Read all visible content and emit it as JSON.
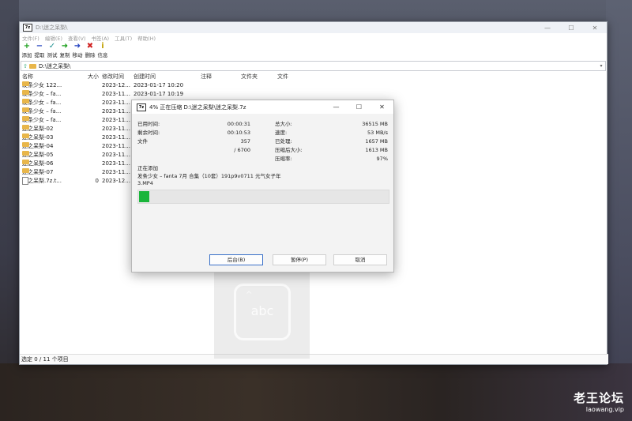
{
  "window": {
    "title": "D:\\迷之呆梨\\",
    "controls": [
      "—",
      "☐",
      "✕"
    ],
    "app_icon_label": "7z"
  },
  "menu": [
    "文件(F)",
    "编辑(E)",
    "查看(V)",
    "书签(A)",
    "工具(T)",
    "帮助(H)"
  ],
  "toolbar": [
    {
      "label": "添加",
      "icon": "add-icon",
      "glyph": "+",
      "color": "#1a9e1a"
    },
    {
      "label": "提取",
      "icon": "extract-icon",
      "glyph": "−",
      "color": "#2040c0"
    },
    {
      "label": "测试",
      "icon": "test-icon",
      "glyph": "✓",
      "color": "#209090"
    },
    {
      "label": "复制",
      "icon": "copy-icon",
      "glyph": "➜",
      "color": "#1a9e1a"
    },
    {
      "label": "移动",
      "icon": "move-icon",
      "glyph": "➜",
      "color": "#2040c0"
    },
    {
      "label": "删除",
      "icon": "delete-icon",
      "glyph": "✖",
      "color": "#d02020"
    },
    {
      "label": "信息",
      "icon": "info-icon",
      "glyph": "i",
      "color": "#c0a000"
    }
  ],
  "address": {
    "path": "D:\\迷之呆梨\\"
  },
  "columns": {
    "name": "名称",
    "size": "大小",
    "modified": "修改时间",
    "created": "创建时间",
    "comment": "注释",
    "folders": "文件夹",
    "files": "文件"
  },
  "rows": [
    {
      "name": "发条少女  122...",
      "size": "",
      "modified": "2023-12...",
      "created": "2023-01-17 10:20",
      "type": "folder"
    },
    {
      "name": "发条少女 – fa...",
      "size": "",
      "modified": "2023-11...",
      "created": "2023-01-17 10:19",
      "type": "folder"
    },
    {
      "name": "发条少女 – fa...",
      "size": "",
      "modified": "2023-11...",
      "created": "",
      "type": "folder"
    },
    {
      "name": "发条少女 – fa...",
      "size": "",
      "modified": "2023-11...",
      "created": "",
      "type": "folder"
    },
    {
      "name": "发条少女 – fa...",
      "size": "",
      "modified": "2023-11...",
      "created": "",
      "type": "folder"
    },
    {
      "name": "迷之呆梨-02",
      "size": "",
      "modified": "2023-11...",
      "created": "",
      "type": "folder"
    },
    {
      "name": "迷之呆梨-03",
      "size": "",
      "modified": "2023-11...",
      "created": "",
      "type": "folder"
    },
    {
      "name": "迷之呆梨-04",
      "size": "",
      "modified": "2023-11...",
      "created": "",
      "type": "folder"
    },
    {
      "name": "迷之呆梨-05",
      "size": "",
      "modified": "2023-11...",
      "created": "",
      "type": "folder"
    },
    {
      "name": "迷之呆梨-06",
      "size": "",
      "modified": "2023-11...",
      "created": "",
      "type": "folder"
    },
    {
      "name": "迷之呆梨-07",
      "size": "",
      "modified": "2023-11...",
      "created": "",
      "type": "folder"
    },
    {
      "name": "迷之呆梨.7z.t...",
      "size": "0",
      "modified": "2023-12...",
      "created": "",
      "type": "file"
    }
  ],
  "status": "选定 0 / 11 个项目",
  "dialog": {
    "title": "4% 正在压缩 D:\\迷之呆梨\\迷之呆梨.7z",
    "controls": [
      "—",
      "☐",
      "✕"
    ],
    "elapsed_label": "已用时间:",
    "elapsed": "00:00:31",
    "remaining_label": "剩余时间:",
    "remaining": "00:10:53",
    "files_label": "文件",
    "files": "357",
    "of_files": "/ 6700",
    "total_label": "总大小:",
    "total": "36515 MB",
    "speed_label": "速度:",
    "speed": "53 MB/s",
    "processed_label": "已处理:",
    "processed": "1657 MB",
    "compressed_label": "压缩后大小:",
    "compressed": "1613 MB",
    "ratio_label": "压缩率:",
    "ratio": "97%",
    "adding_label": "正在添加",
    "current_file": "发条少女 – fanta 7月 合集（10套）191p9v0711 元气女子年\n3.MP4",
    "progress": 0.04,
    "progress_color": "#19b53a",
    "buttons": {
      "background": "后台(B)",
      "pause": "暂停(P)",
      "cancel": "取消"
    }
  },
  "ime": {
    "text": "abc"
  },
  "watermark": {
    "title": "老王论坛",
    "url": "laowang.vip"
  }
}
